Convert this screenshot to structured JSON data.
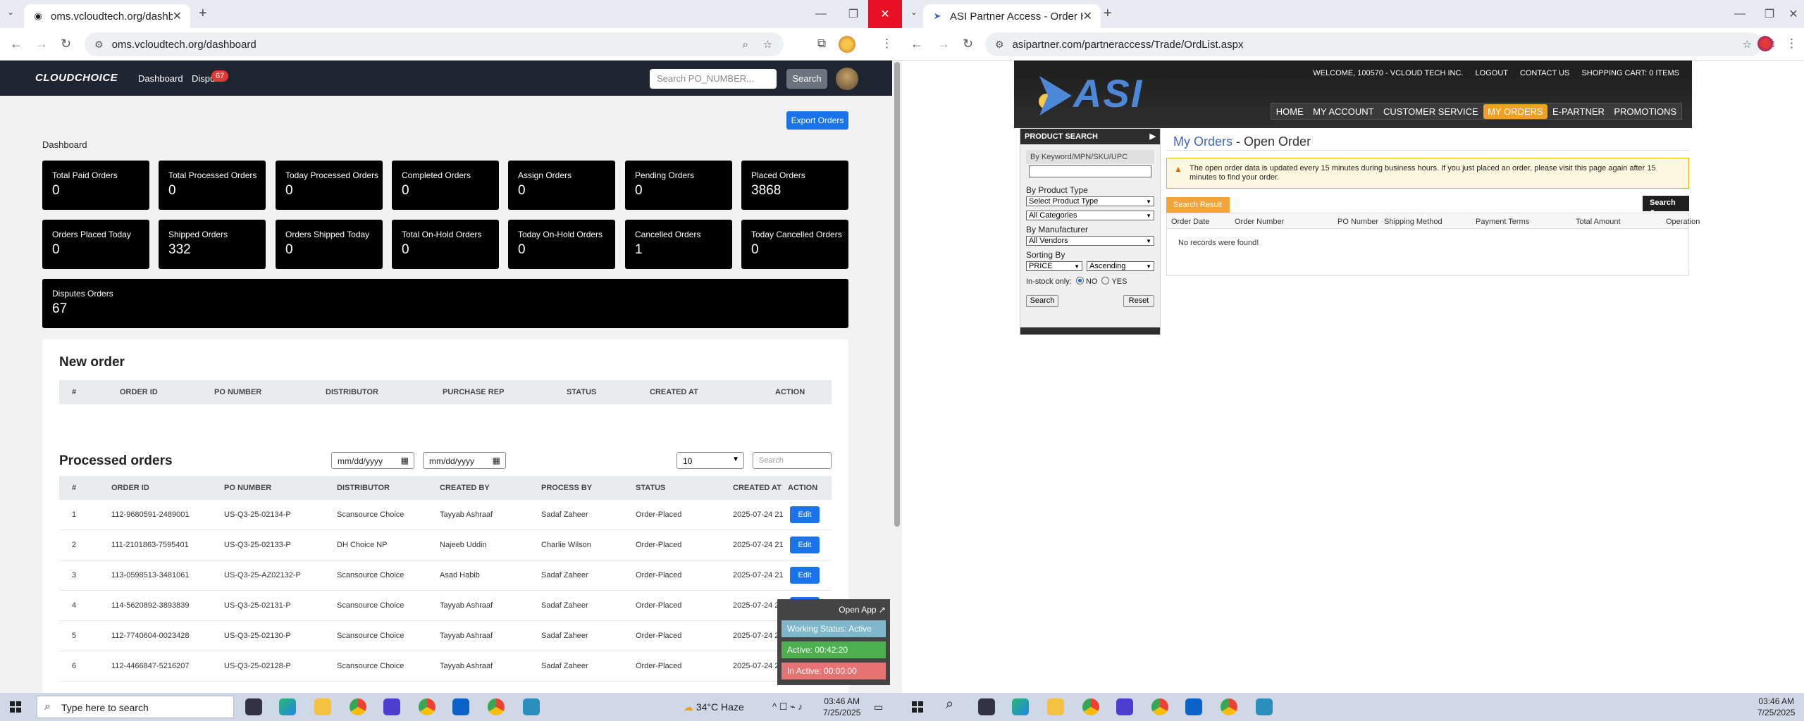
{
  "left_browser": {
    "tab_title": "oms.vcloudtech.org/dashboard",
    "url": "oms.vcloudtech.org/dashboard",
    "app": {
      "logo": "CLOUDCHOICE",
      "nav": [
        {
          "label": "Dashboard"
        },
        {
          "label": "Dispu"
        }
      ],
      "disputes_badge": "67",
      "search_placeholder": "Search PO_NUMBER...",
      "search_button": "Search",
      "export_button": "Export Orders",
      "dashboard_title": "Dashboard",
      "cards": [
        {
          "label": "Total Paid Orders",
          "value": "0"
        },
        {
          "label": "Total Processed Orders",
          "value": "0"
        },
        {
          "label": "Today Processed Orders",
          "value": "0"
        },
        {
          "label": "Completed Orders",
          "value": "0"
        },
        {
          "label": "Assign Orders",
          "value": "0"
        },
        {
          "label": "Pending Orders",
          "value": "0"
        },
        {
          "label": "Placed Orders",
          "value": "3868"
        },
        {
          "label": "Orders Placed Today",
          "value": "0"
        },
        {
          "label": "Shipped Orders",
          "value": "332"
        },
        {
          "label": "Orders Shipped Today",
          "value": "0"
        },
        {
          "label": "Total On-Hold Orders",
          "value": "0"
        },
        {
          "label": "Today On-Hold Orders",
          "value": "0"
        },
        {
          "label": "Cancelled Orders",
          "value": "1"
        },
        {
          "label": "Today Cancelled Orders",
          "value": "0"
        },
        {
          "label": "Disputes Orders",
          "value": "67"
        }
      ],
      "new_order": {
        "title": "New order",
        "columns": [
          "#",
          "ORDER ID",
          "PO NUMBER",
          "DISTRIBUTOR",
          "PURCHASE REP",
          "STATUS",
          "CREATED AT",
          "ACTION"
        ]
      },
      "processed": {
        "title": "Processed orders",
        "date_from": "mm/dd/yyyy",
        "date_to": "mm/dd/yyyy",
        "page_size": "10",
        "search_placeholder": "Search",
        "columns": [
          "#",
          "ORDER ID",
          "PO NUMBER",
          "DISTRIBUTOR",
          "CREATED BY",
          "PROCESS BY",
          "STATUS",
          "CREATED AT",
          "ACTION"
        ],
        "edit_label": "Edit",
        "rows": [
          [
            "1",
            "112-9680591-2489001",
            "US-Q3-25-02134-P",
            "Scansource Choice",
            "Tayyab Ashraaf",
            "Sadaf Zaheer",
            "Order-Placed",
            "2025-07-24 21"
          ],
          [
            "2",
            "111-2101863-7595401",
            "US-Q3-25-02133-P",
            "DH Choice NP",
            "Najeeb Uddin",
            "Charlie Wilson",
            "Order-Placed",
            "2025-07-24 21"
          ],
          [
            "3",
            "113-0598513-3481061",
            "US-Q3-25-AZ02132-P",
            "Scansource Choice",
            "Asad Habib",
            "Sadaf Zaheer",
            "Order-Placed",
            "2025-07-24 21"
          ],
          [
            "4",
            "114-5620892-3893839",
            "US-Q3-25-02131-P",
            "Scansource Choice",
            "Tayyab Ashraaf",
            "Sadaf Zaheer",
            "Order-Placed",
            "2025-07-24 21"
          ],
          [
            "5",
            "112-7740604-0023428",
            "US-Q3-25-02130-P",
            "Scansource Choice",
            "Tayyab Ashraaf",
            "Sadaf Zaheer",
            "Order-Placed",
            "2025-07-24 21"
          ],
          [
            "6",
            "112-4466847-5216207",
            "US-Q3-25-02128-P",
            "Scansource Choice",
            "Tayyab Ashraaf",
            "Sadaf Zaheer",
            "Order-Placed",
            "2025-07-24 21"
          ]
        ]
      }
    },
    "tracker": {
      "open_app": "Open App ↗",
      "working_status": "Working Status: Active",
      "active": "Active: 00:42:20",
      "inactive": "In Active: 00:00:00"
    }
  },
  "right_browser": {
    "tab_title": "ASI Partner Access - Order Hist",
    "url": "asipartner.com/partneraccess/Trade/OrdList.aspx",
    "site": {
      "logo": "ASI",
      "top_links": [
        "WELCOME, 100570 - VCLOUD TECH INC.",
        "LOGOUT",
        "CONTACT US",
        "SHOPPING CART: 0 ITEMS"
      ],
      "nav": [
        "HOME",
        "MY ACCOUNT",
        "CUSTOMER SERVICE",
        "MY ORDERS",
        "E-PARTNER",
        "PROMOTIONS"
      ],
      "product_search": {
        "title": "PRODUCT SEARCH",
        "keyword_label": "By Keyword/MPN/SKU/UPC",
        "product_type_label": "By Product Type",
        "product_type_select": "Select Product Type",
        "category_select": "All Categories",
        "manufacturer_label": "By Manufacturer",
        "vendor_select": "All Vendors",
        "sorting_label": "Sorting By",
        "sort_field": "PRICE",
        "sort_order": "Ascending",
        "instock_label": "In-stock only:",
        "no_label": "NO",
        "yes_label": "YES",
        "search_button": "Search",
        "reset_button": "Reset"
      },
      "page_title_link": "My Orders",
      "page_title_rest": " - Open Order",
      "notice": "The open order data is updated every 15 minutes during business hours. If you just placed an order, please visit this page again after 15 minutes to find your order.",
      "search_result_tab": "Search Result",
      "search_button": "Search",
      "columns": [
        "Order Date",
        "Order Number",
        "PO Number",
        "Shipping Method",
        "Payment Terms",
        "Total Amount",
        "Operation"
      ],
      "empty_message": "No records were found!"
    }
  },
  "taskbar": {
    "search_placeholder": "Type here to search",
    "weather": "34°C  Haze",
    "left_time": "03:46 AM",
    "left_date": "7/25/2025",
    "right_time": "03:46 AM",
    "right_date": "7/25/2025"
  },
  "colors": {
    "accent": "#1a73e8",
    "asi_orange": "#f0a022",
    "navbar": "#1e2632",
    "active_green": "#4caf50",
    "inactive_red": "#e57373",
    "working_blue": "#7fb6c9"
  }
}
